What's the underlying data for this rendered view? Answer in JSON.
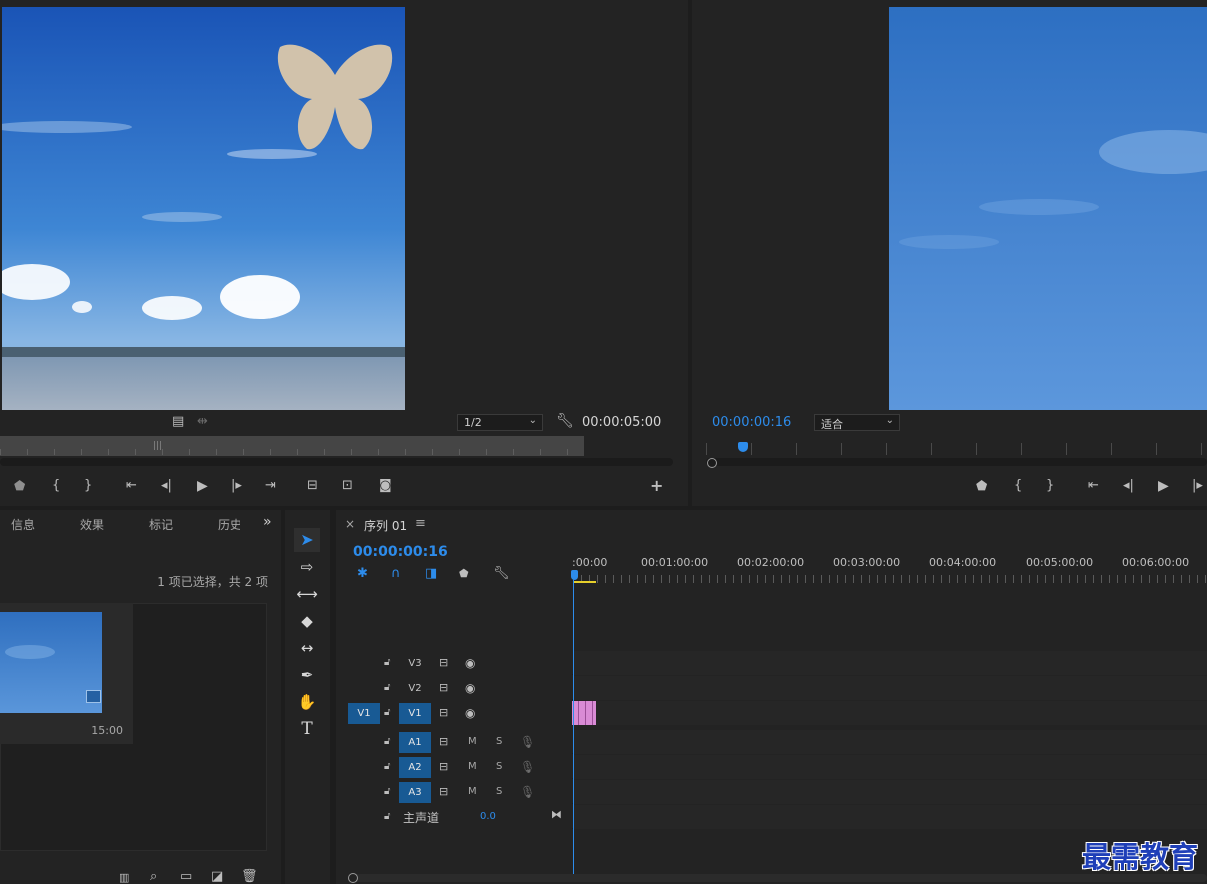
{
  "source_monitor": {
    "resolution": "1/2",
    "timecode": "00:00:05:00"
  },
  "program_monitor": {
    "timecode": "00:00:00:16",
    "zoom": "适合"
  },
  "project_panel": {
    "tabs": [
      "信息",
      "效果",
      "标记",
      "历史"
    ],
    "overflow": "»",
    "selection_status": "1 项已选择，共 2 项",
    "clip_duration": "15:00"
  },
  "timeline": {
    "close": "×",
    "sequence_name": "序列 01",
    "menu": "≡",
    "timecode": "00:00:00:16",
    "ruler_labels": [
      ":00:00",
      "00:01:00:00",
      "00:02:00:00",
      "00:03:00:00",
      "00:04:00:00",
      "00:05:00:00",
      "00:06:00:00"
    ],
    "tracks": {
      "v3": "V3",
      "v2": "V2",
      "v1": "V1",
      "v1_source": "V1",
      "a1": "A1",
      "a2": "A2",
      "a3": "A3",
      "mute": "M",
      "solo": "S"
    },
    "master": {
      "label": "主声道",
      "value": "0.0"
    }
  },
  "watermark": "最需教育",
  "colors": {
    "accent": "#2d8ceb",
    "clip": "#d98bd5",
    "track_selected": "#185a94"
  }
}
